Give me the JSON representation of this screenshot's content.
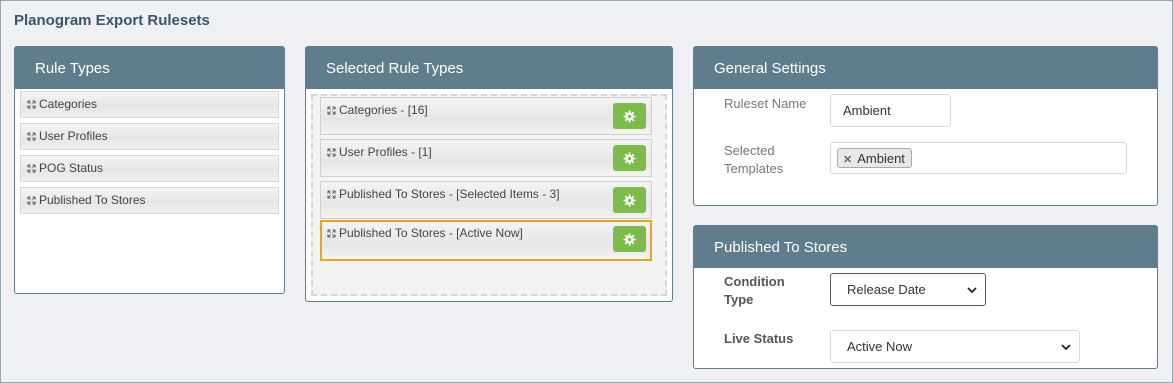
{
  "page": {
    "title": "Planogram Export Rulesets"
  },
  "rule_types": {
    "header": "Rule Types",
    "items": [
      {
        "label": "Categories"
      },
      {
        "label": "User Profiles"
      },
      {
        "label": "POG Status"
      },
      {
        "label": "Published To Stores"
      }
    ]
  },
  "selected_rule_types": {
    "header": "Selected Rule Types",
    "items": [
      {
        "label": "Categories - [16]",
        "active": false
      },
      {
        "label": "User Profiles - [1]",
        "active": false
      },
      {
        "label": "Published To Stores - [Selected Items - 3]",
        "active": false
      },
      {
        "label": "Published To Stores - [Active Now]",
        "active": true
      }
    ]
  },
  "general_settings": {
    "header": "General Settings",
    "ruleset_name_label": "Ruleset Name",
    "ruleset_name_value": "Ambient",
    "selected_templates_label_line1": "Selected",
    "selected_templates_label_line2": "Templates",
    "templates": [
      "Ambient"
    ]
  },
  "published_to_stores": {
    "header": "Published To Stores",
    "condition_type_label_line1": "Condition",
    "condition_type_label_line2": "Type",
    "condition_type_value": "Release Date",
    "live_status_label": "Live Status",
    "live_status_value": "Active Now"
  },
  "colors": {
    "header_bg": "#5f7d8c",
    "gear_button": "#7dbb4a",
    "active_border": "#f0a020",
    "page_bg": "#eef0f4"
  },
  "icons": {
    "drag": "move-icon",
    "settings": "gear-icon",
    "remove_tag": "close-icon",
    "dropdown": "chevron-down-icon"
  }
}
